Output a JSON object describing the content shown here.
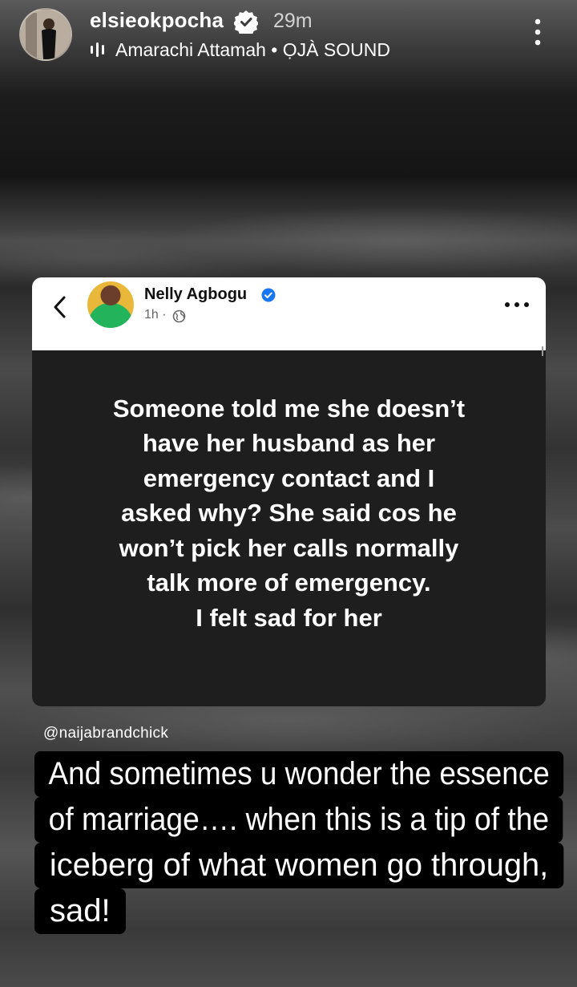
{
  "header": {
    "username": "elsieokpocha",
    "time_ago": "29m",
    "music": "Amarachi Attamah • ỌJÀ SOUND"
  },
  "post": {
    "author": "Nelly Agbogu",
    "time": "1h ·",
    "text_lines": [
      "Someone told me she doesn’t",
      "have her husband as her",
      "emergency contact and I",
      "asked why? She said cos he",
      "won’t pick her calls normally",
      "talk more of emergency.",
      "I felt sad for her"
    ]
  },
  "mention": "@naijabrandchick",
  "caption_lines": [
    "And sometimes u wonder the essence",
    "of marriage…. when this is a tip of the",
    "iceberg of what women go through,",
    "sad!"
  ],
  "colors": {
    "verified": "#0095f6",
    "card_dark": "#1e1e1e"
  }
}
